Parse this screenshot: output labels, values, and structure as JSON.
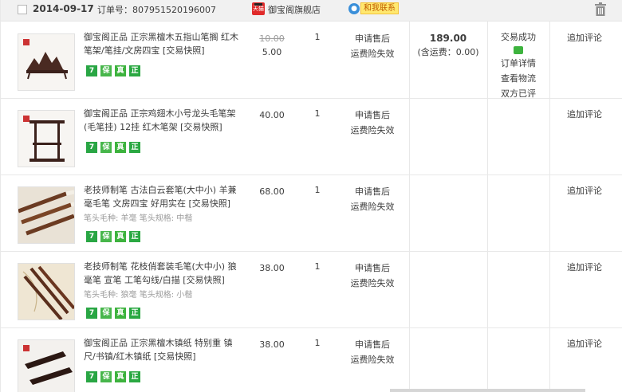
{
  "header": {
    "date": "2014-09-17",
    "order_label": "订单号：",
    "order_number": "807951520196007",
    "shop_logo_text": "天猫",
    "shop_name": "御宝阁旗舰店",
    "contact_label": "和我联系",
    "contact_icon": "chat-bubble-icon",
    "trash_icon": "trash-icon"
  },
  "items": [
    {
      "title": "御宝阁正品 正宗黑檀木五指山笔搁 红木笔架/笔挂/文房四宝",
      "snapshot": "[交易快照]",
      "spec": "",
      "old_price": "10.00",
      "price": "5.00",
      "qty": "1",
      "service_1": "申请售后",
      "service_2": "运费险失效",
      "comment": "追加评论"
    },
    {
      "title": "御宝阁正品 正宗鸡翅木小号龙头毛笔架(毛笔挂) 12挂 红木笔架",
      "snapshot": "[交易快照]",
      "spec": "",
      "old_price": "",
      "price": "40.00",
      "qty": "1",
      "service_1": "申请售后",
      "service_2": "运费险失效",
      "comment": "追加评论"
    },
    {
      "title": "老技师制笔 古法白云套笔(大中小) 羊兼毫毛笔 文房四宝 好用实在",
      "snapshot": "[交易快照]",
      "spec": "笔头毛种: 羊毫  笔头规格: 中楷",
      "old_price": "",
      "price": "68.00",
      "qty": "1",
      "service_1": "申请售后",
      "service_2": "运费险失效",
      "comment": "追加评论"
    },
    {
      "title": "老技师制笔 花枝俏套装毛笔(大中小) 狼毫笔 宣笔 工笔勾线/白描",
      "snapshot": "[交易快照]",
      "spec": "笔头毛种: 狼毫  笔头规格: 小楷",
      "old_price": "",
      "price": "38.00",
      "qty": "1",
      "service_1": "申请售后",
      "service_2": "运费险失效",
      "comment": "追加评论"
    },
    {
      "title": "御宝阁正品 正宗黑檀木镇纸 特别重 镇尺/书镇/红木镇纸",
      "snapshot": "[交易快照]",
      "spec": "",
      "old_price": "",
      "price": "38.00",
      "qty": "1",
      "service_1": "申请售后",
      "service_2": "运费险失效",
      "comment": "追加评论"
    }
  ],
  "badges": [
    "7",
    "保",
    "真",
    "正"
  ],
  "total": {
    "amount": "189.00",
    "shipping": "(含运费：0.00)"
  },
  "status": {
    "state": "交易成功",
    "detail": "订单详情",
    "logistics": "查看物流",
    "rated": "双方已评"
  }
}
